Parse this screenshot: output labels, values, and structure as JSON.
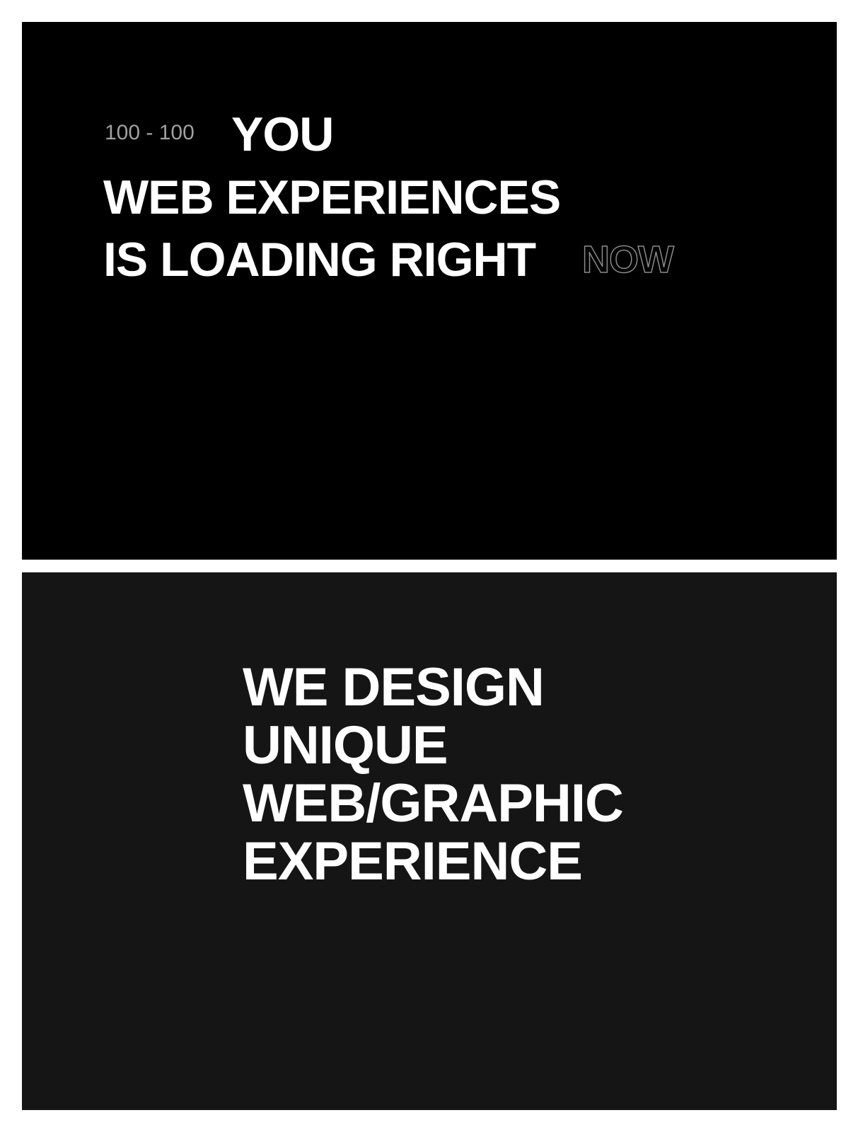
{
  "loader": {
    "counter": "100 - 100",
    "lines": [
      "YOU",
      "WEB EXPERIENCES",
      "IS LOADING RIGHT"
    ],
    "outline_word": "NOW"
  },
  "hero": {
    "lines": [
      "WE DESIGN",
      "UNIQUE",
      "WEB/GRAPHIC",
      "EXPERIENCE"
    ]
  },
  "colors": {
    "loader_background": "#000000",
    "hero_background": "#151515",
    "text": "#ffffff",
    "counter_text": "#a0a0a0",
    "outline_stroke": "#8a8a8a",
    "page_background": "#ffffff"
  }
}
